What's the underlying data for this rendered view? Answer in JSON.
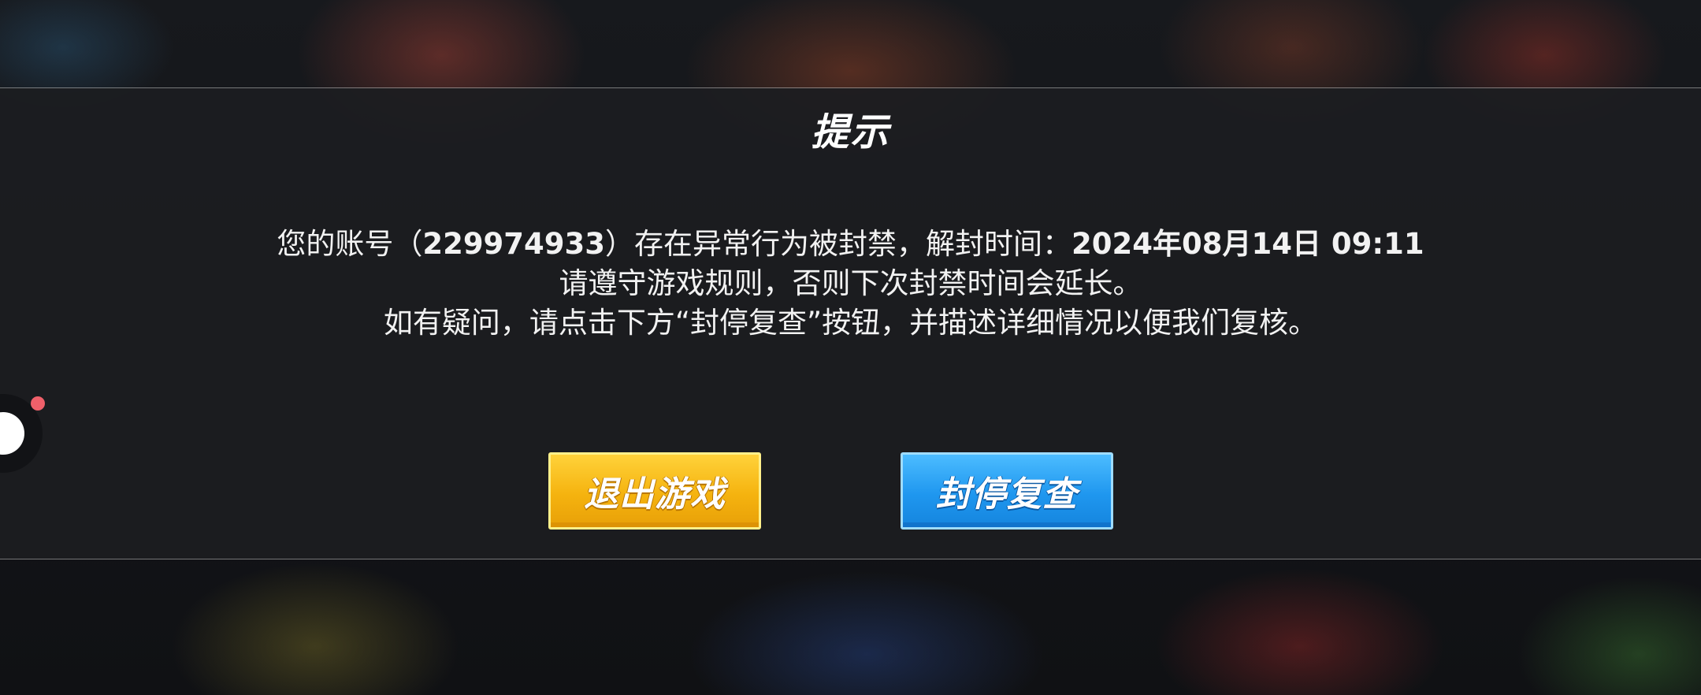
{
  "dialog": {
    "title": "提示",
    "message": {
      "line1_prefix": "您的账号（",
      "account_id": "229974933",
      "line1_middle": "）存在异常行为被封禁，解封时间：",
      "unban_time": "2024年08月14日 09:11",
      "line2": "请遵守游戏规则，否则下次封禁时间会延长。",
      "line3": "如有疑问，请点击下方“封停复查”按钮，并描述详细情况以便我们复核。"
    },
    "buttons": {
      "exit_label": "退出游戏",
      "appeal_label": "封停复查"
    }
  },
  "colors": {
    "exit_button": "#f5b30f",
    "appeal_button": "#1f97ef",
    "badge": "#f0606a"
  },
  "icons": {
    "floating_assistant": "floating-ball-icon",
    "notification_badge": "red-dot-badge"
  }
}
